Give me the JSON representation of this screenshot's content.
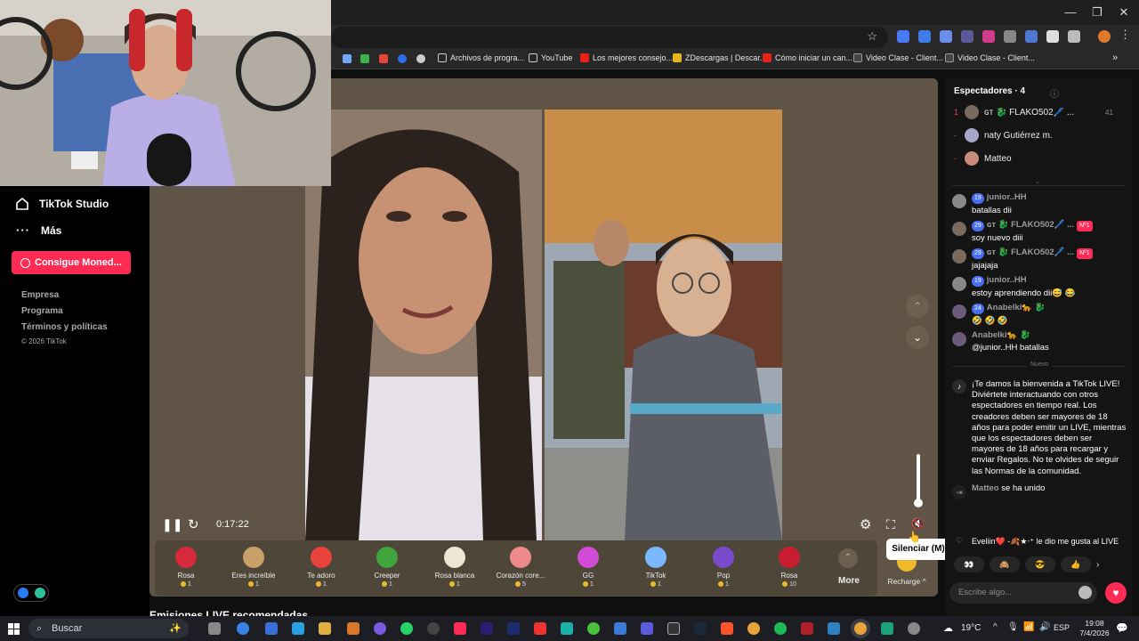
{
  "browser": {
    "bookmarks": [
      "Archivos de progra...",
      "YouTube",
      "Los mejores consejo...",
      "ZDescargas | Descar...",
      "Cómo iniciar un can...",
      "Video Clase - Client...",
      "Video Clase - Client..."
    ],
    "window_min": "—",
    "window_restore": "❐",
    "window_close": "✕"
  },
  "nav": {
    "studio": "TikTok Studio",
    "more": "Más",
    "coins_button": "Consigue Moned...",
    "footer_links": [
      "Empresa",
      "Programa",
      "Términos y políticas"
    ],
    "copyright": "© 2026 TikTok"
  },
  "player": {
    "time": "0:17:22",
    "tooltip": "Silenciar (M)"
  },
  "gifts": {
    "items": [
      {
        "name": "Rosa",
        "price": "1",
        "color": "#d62a3c"
      },
      {
        "name": "Eres increíble",
        "price": "1",
        "color": "#c9a06a"
      },
      {
        "name": "Te adoro",
        "price": "1",
        "color": "#e8433d"
      },
      {
        "name": "Creeper",
        "price": "1",
        "color": "#3fa43a"
      },
      {
        "name": "Rosa blanca",
        "price": "1",
        "color": "#ece6d2"
      },
      {
        "name": "Corazón core...",
        "price": "5",
        "color": "#ef8a8a"
      },
      {
        "name": "GG",
        "price": "1",
        "color": "#d24bd6"
      },
      {
        "name": "TikTok",
        "price": "1",
        "color": "#7ab9ff"
      },
      {
        "name": "Pop",
        "price": "1",
        "color": "#7a4ccc"
      },
      {
        "name": "Rosa",
        "price": "10",
        "color": "#c81d2e"
      }
    ],
    "more_label": "More",
    "recharge_label": "Recharge ^"
  },
  "recommended_title": "Emisiones LIVE recomendadas",
  "chat": {
    "viewers_title": "Espectadores · 4",
    "viewers": [
      {
        "rank": "1",
        "name": "ɢᴛ 🐉 FLAKO502🖊️ ...",
        "score": "41"
      },
      {
        "rank": "-",
        "name": "naty Gutiérrez m.",
        "score": ""
      },
      {
        "rank": "-",
        "name": "Matteo",
        "score": ""
      }
    ],
    "messages": [
      {
        "level": "19",
        "name": "junior..HH",
        "tag": "",
        "text": "batallas dii"
      },
      {
        "level": "29",
        "name": "ɢᴛ 🐉 FLAKO502🖊️ ...",
        "tag": "Nº1",
        "text": "soy nuevo diii"
      },
      {
        "level": "29",
        "name": "ɢᴛ 🐉 FLAKO502🖊️ ...",
        "tag": "Nº1",
        "text": "jajajaja"
      },
      {
        "level": "19",
        "name": "junior..HH",
        "tag": "",
        "text": "estoy aprendiendo dii😅 😂"
      },
      {
        "level": "24",
        "name": "Anabelki🐆 🐉",
        "tag": "",
        "text": "🤣 🤣 🤣"
      },
      {
        "level": "",
        "name": "Anabelki🐆 🐉",
        "tag": "",
        "text": "@junior..HH batallas"
      }
    ],
    "new_label": "Nuevo",
    "welcome": "¡Te damos la bienvenida a TikTok LIVE! Diviértete interactuando con otros espectadores en tiempo real. Los creadores deben ser mayores de 18 años para poder emitir un LIVE, mientras que los espectadores deben ser mayores de 18 años para recargar y enviar Regalos. No te olvides de seguir las Normas de la comunidad.",
    "joined_name": "Matteo",
    "joined_text": "se ha unido",
    "like_text": "Eveliin❤️ -🍂★‧⁺ le dio me gusta al LIVE",
    "placeholder": "Escribe algo..."
  },
  "taskbar": {
    "search": "Buscar",
    "temperature": "19°C",
    "lang": "ESP",
    "time": "19:08",
    "date": "7/4/2026"
  }
}
